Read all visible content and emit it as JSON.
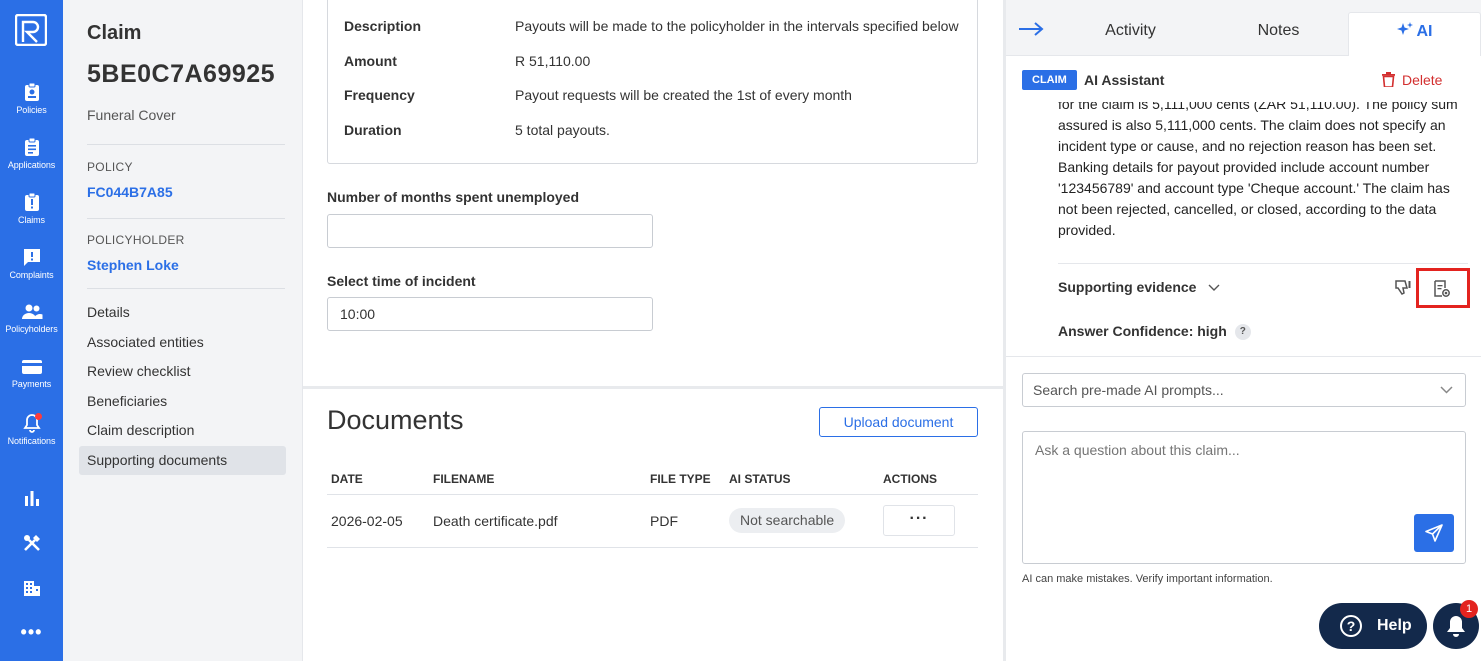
{
  "nav": {
    "items": [
      {
        "label": "Policies",
        "icon": "policies-icon"
      },
      {
        "label": "Applications",
        "icon": "applications-icon"
      },
      {
        "label": "Claims",
        "icon": "claims-icon"
      },
      {
        "label": "Complaints",
        "icon": "complaints-icon"
      },
      {
        "label": "Policyholders",
        "icon": "policyholders-icon"
      },
      {
        "label": "Payments",
        "icon": "payments-icon"
      },
      {
        "label": "Notifications",
        "icon": "notifications-icon"
      }
    ]
  },
  "claim": {
    "title": "Claim",
    "id": "5BE0C7A69925",
    "product": "Funeral Cover",
    "policy_label": "POLICY",
    "policy_number": "FC044B7A85",
    "policyholder_label": "POLICYHOLDER",
    "policyholder_name": "Stephen Loke",
    "menu": [
      "Details",
      "Associated entities",
      "Review checklist",
      "Beneficiaries",
      "Claim description",
      "Supporting documents"
    ]
  },
  "payout": {
    "rows": [
      {
        "key": "Description",
        "value": "Payouts will be made to the policyholder in the intervals specified below"
      },
      {
        "key": "Amount",
        "value": "R 51,110.00"
      },
      {
        "key": "Frequency",
        "value": "Payout requests will be created the 1st of every month"
      },
      {
        "key": "Duration",
        "value": "5 total payouts."
      }
    ]
  },
  "form": {
    "months_label": "Number of months spent unemployed",
    "months_value": "",
    "time_label": "Select time of incident",
    "time_value": "10:00"
  },
  "documents": {
    "title": "Documents",
    "upload_label": "Upload document",
    "headers": [
      "DATE",
      "FILENAME",
      "FILE TYPE",
      "AI STATUS",
      "ACTIONS"
    ],
    "rows": [
      {
        "date": "2026-02-05",
        "filename": "Death certificate.pdf",
        "file_type": "PDF",
        "ai_status": "Not searchable",
        "actions": "···"
      }
    ]
  },
  "ai_panel": {
    "tabs": [
      "Activity",
      "Notes",
      "AI"
    ],
    "badge": "CLAIM",
    "title": "AI Assistant",
    "delete_label": "Delete",
    "answer": "for the claim is 5,111,000 cents (ZAR 51,110.00). The policy sum assured is also 5,111,000 cents. The claim does not specify an incident type or cause, and no rejection reason has been set. Banking details for payout provided include account number '123456789' and account type 'Cheque account.' The claim has not been rejected, cancelled, or closed, according to the data provided.",
    "evidence_label": "Supporting evidence",
    "confidence_label": "Answer Confidence: high",
    "confidence_help": "?",
    "prompt_placeholder": "Search pre-made AI prompts...",
    "question_placeholder": "Ask a question about this claim...",
    "disclaimer": "AI can make mistakes. Verify important information.",
    "help_label": "Help",
    "help_q": "?",
    "notification_count": "1"
  },
  "colors": {
    "accent": "#2b6fe6",
    "danger": "#d32f2f",
    "highlight": "#e3231f",
    "navy": "#13294b"
  }
}
